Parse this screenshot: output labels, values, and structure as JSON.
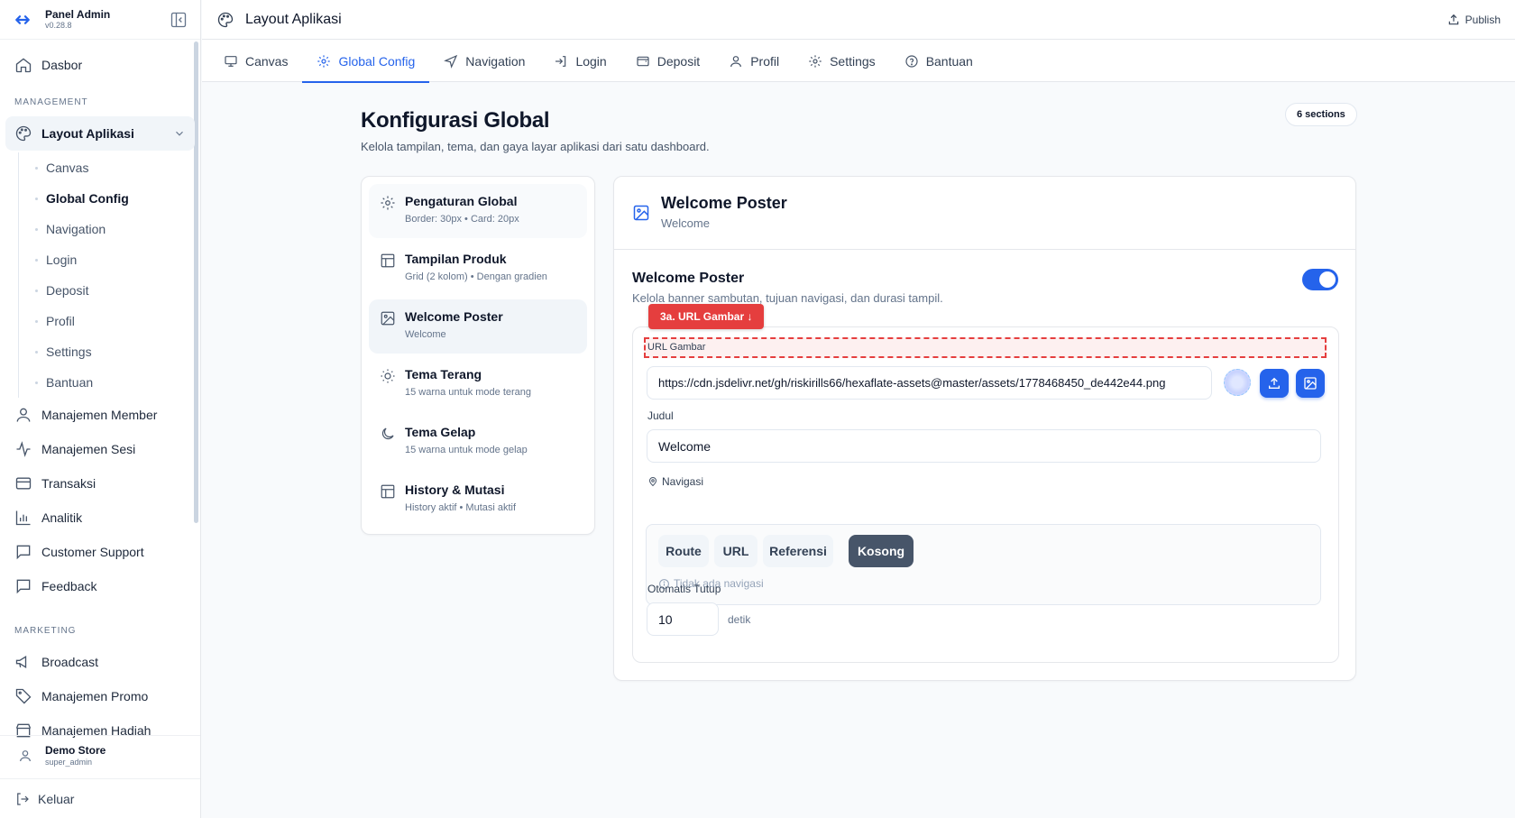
{
  "app": {
    "name": "Panel Admin",
    "version": "v0.28.8"
  },
  "sidebar": {
    "dashboard": "Dasbor",
    "section_management": "MANAGEMENT",
    "layout_group": "Layout Aplikasi",
    "layout_sub": [
      "Canvas",
      "Global Config",
      "Navigation",
      "Login",
      "Deposit",
      "Profil",
      "Settings",
      "Bantuan"
    ],
    "items": [
      "Manajemen Member",
      "Manajemen Sesi",
      "Transaksi",
      "Analitik",
      "Customer Support",
      "Feedback"
    ],
    "section_marketing": "MARKETING",
    "marketing": [
      "Broadcast",
      "Manajemen Promo",
      "Manajemen Hadiah"
    ],
    "user_name": "Demo Store",
    "user_role": "super_admin",
    "logout": "Keluar"
  },
  "topbar": {
    "title": "Layout Aplikasi",
    "publish": "Publish"
  },
  "tabs": [
    "Canvas",
    "Global Config",
    "Navigation",
    "Login",
    "Deposit",
    "Profil",
    "Settings",
    "Bantuan"
  ],
  "page": {
    "title": "Konfigurasi Global",
    "subtitle": "Kelola tampilan, tema, dan gaya layar aplikasi dari satu dashboard.",
    "badge": "6 sections"
  },
  "sections": [
    {
      "title": "Pengaturan Global",
      "desc": "Border: 30px • Card: 20px",
      "icon": "gear-icon"
    },
    {
      "title": "Tampilan Produk",
      "desc": "Grid (2 kolom) • Dengan gradien",
      "icon": "layout-icon"
    },
    {
      "title": "Welcome Poster",
      "desc": "Welcome",
      "icon": "image-icon"
    },
    {
      "title": "Tema Terang",
      "desc": "15 warna untuk mode terang",
      "icon": "sun-icon"
    },
    {
      "title": "Tema Gelap",
      "desc": "15 warna untuk mode gelap",
      "icon": "moon-icon"
    },
    {
      "title": "History & Mutasi",
      "desc": "History aktif • Mutasi aktif",
      "icon": "layout-icon"
    }
  ],
  "panel": {
    "title": "Welcome Poster",
    "subtitle": "Welcome",
    "section_title": "Welcome Poster",
    "section_desc": "Kelola banner sambutan, tujuan navigasi, dan durasi tampil.",
    "enabled": true,
    "flag": "3a. URL Gambar ↓",
    "url_label": "URL Gambar",
    "url_value": "https://cdn.jsdelivr.net/gh/riskirills66/hexaflate-assets@master/assets/1778468450_de442e44.png",
    "title_label": "Judul",
    "title_value": "Welcome",
    "nav_label": "Navigasi",
    "nav_options": [
      "Route",
      "URL",
      "Referensi",
      "Kosong"
    ],
    "nav_selected": "Kosong",
    "nav_hint": "Tidak ada navigasi",
    "close_label": "Otomatis Tutup",
    "close_value": "10",
    "close_unit": "detik"
  },
  "colors": {
    "accent": "#2563eb",
    "flag": "#e53e3e",
    "segment_active": "#475569"
  }
}
